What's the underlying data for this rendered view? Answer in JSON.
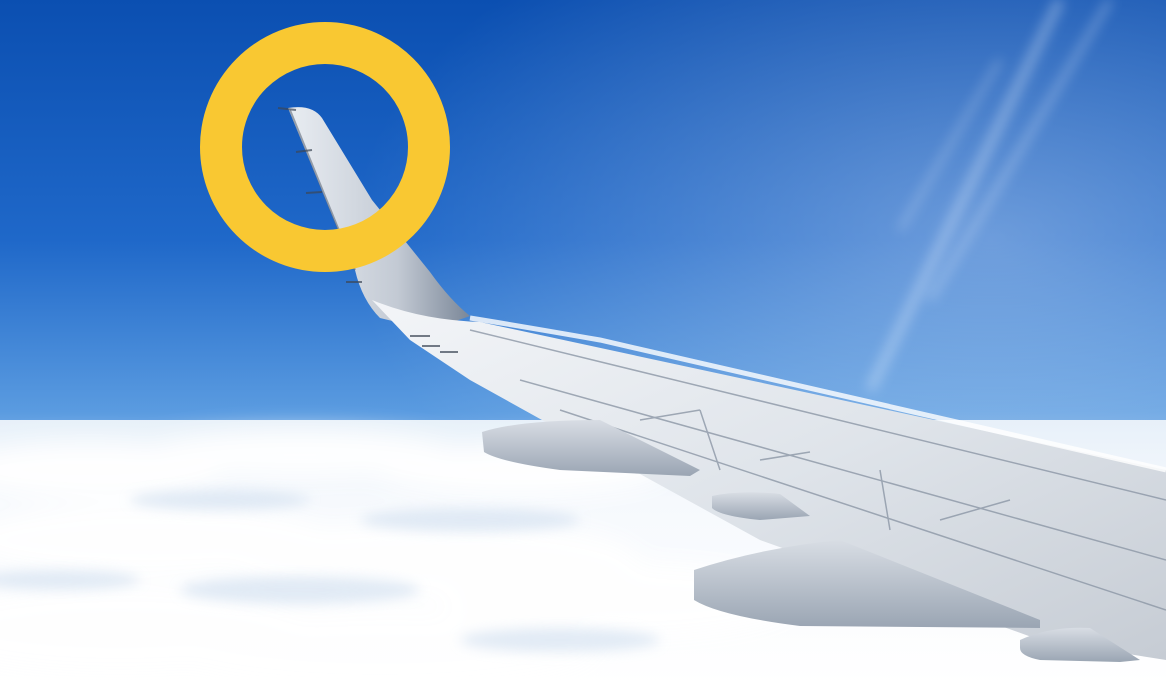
{
  "photo": {
    "subject": "airplane-wing",
    "highlight": {
      "shape": "ring",
      "target": "winglet",
      "color": "#f9c832"
    },
    "colors": {
      "sky_top": "#0b4fb1",
      "sky_mid": "#2f7fd8",
      "sky_horizon": "#a9cdf0",
      "clouds": "#f4f8fc",
      "wing_light": "#e7ebf0",
      "wing_shadow": "#9aa5b3"
    }
  }
}
